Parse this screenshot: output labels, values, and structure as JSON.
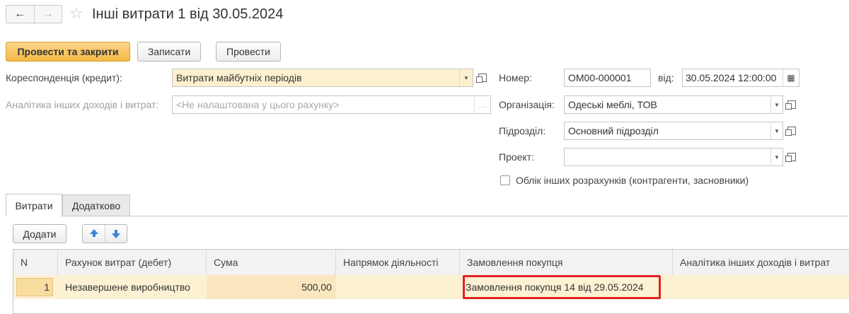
{
  "window": {
    "title": "Інші витрати 1 від 30.05.2024",
    "back_icon": "←",
    "forward_icon": "→",
    "star_icon": "☆"
  },
  "toolbar": {
    "post_close_label": "Провести та закрити",
    "save_label": "Записати",
    "post_label": "Провести"
  },
  "form": {
    "correspondence_label": "Кореспонденція (кредит):",
    "correspondence_value": "Витрати майбутніх періодів",
    "analytics_label": "Аналітика інших доходів і витрат:",
    "analytics_value": "<Не налаштована у цього рахунку>",
    "number_label": "Номер:",
    "number_value": "ОМ00-000001",
    "date_label": "від:",
    "date_value": "30.05.2024 12:00:00",
    "organization_label": "Організація:",
    "organization_value": "Одеські меблі, ТОВ",
    "subdivision_label": "Підрозділ:",
    "subdivision_value": "Основний підрозділ",
    "project_label": "Проект:",
    "project_value": "",
    "other_settlements_label": "Облік інших розрахунків (контрагенти, засновники)",
    "other_settlements_checked": false
  },
  "tabs": [
    {
      "label": "Витрати",
      "active": true
    },
    {
      "label": "Додатково",
      "active": false
    }
  ],
  "table_toolbar": {
    "add_label": "Додати"
  },
  "table": {
    "columns": [
      "N",
      "Рахунок витрат (дебет)",
      "Сума",
      "Напрямок діяльності",
      "Замовлення покупця",
      "Аналітика інших доходів і витрат"
    ],
    "rows": [
      {
        "n": "1",
        "account": "Незавершене виробництво",
        "sum": "500,00",
        "direction": "",
        "order": "Замовлення покупця 14 від 29.05.2024",
        "analytics": ""
      }
    ]
  },
  "colors": {
    "primary_button": "#f4b947",
    "highlight_field": "#fcf0cf",
    "selected_row": "#fdf1d4",
    "annotation_box": "#e32222",
    "arrow": "#3a86d4"
  }
}
